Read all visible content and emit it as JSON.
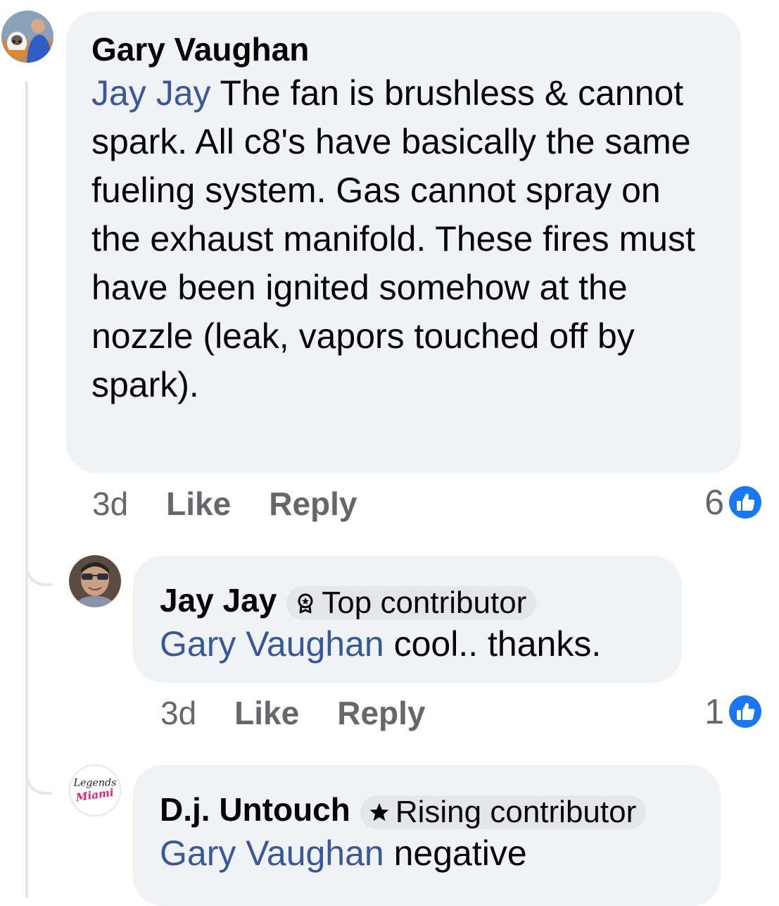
{
  "comments": [
    {
      "author": "Gary Vaughan",
      "mention": "Jay Jay",
      "text": " The fan is brushless & cannot spark. All c8's have basically the same fueling system. Gas cannot spray on the exhaust manifold. These fires must have been ignited somehow at the nozzle (leak, vapors touched off by spark).",
      "time": "3d",
      "like_label": "Like",
      "reply_label": "Reply",
      "reaction_count": "6",
      "avatar_icon": "person-with-dog-avatar"
    },
    {
      "author": "Jay Jay",
      "badge": "Top contributor",
      "badge_icon": "top-contributor-icon",
      "mention": "Gary Vaughan",
      "text": " cool.. thanks.",
      "time": "3d",
      "like_label": "Like",
      "reply_label": "Reply",
      "reaction_count": "1",
      "avatar_icon": "man-with-sunglasses-avatar"
    },
    {
      "author": "D.j. Untouch",
      "badge": "Rising contributor",
      "badge_icon": "star-icon",
      "mention": "Gary Vaughan",
      "text": " negative",
      "avatar_logo_text": [
        "Legends",
        "Miami"
      ],
      "avatar_icon": "legends-miami-logo-avatar"
    }
  ],
  "colors": {
    "bubble": "#f0f2f5",
    "mention": "#385898",
    "meta": "#65676b",
    "like_blue": "#1877f2",
    "thread_line": "#e4e6eb",
    "logo_pink": "#e0237a"
  }
}
